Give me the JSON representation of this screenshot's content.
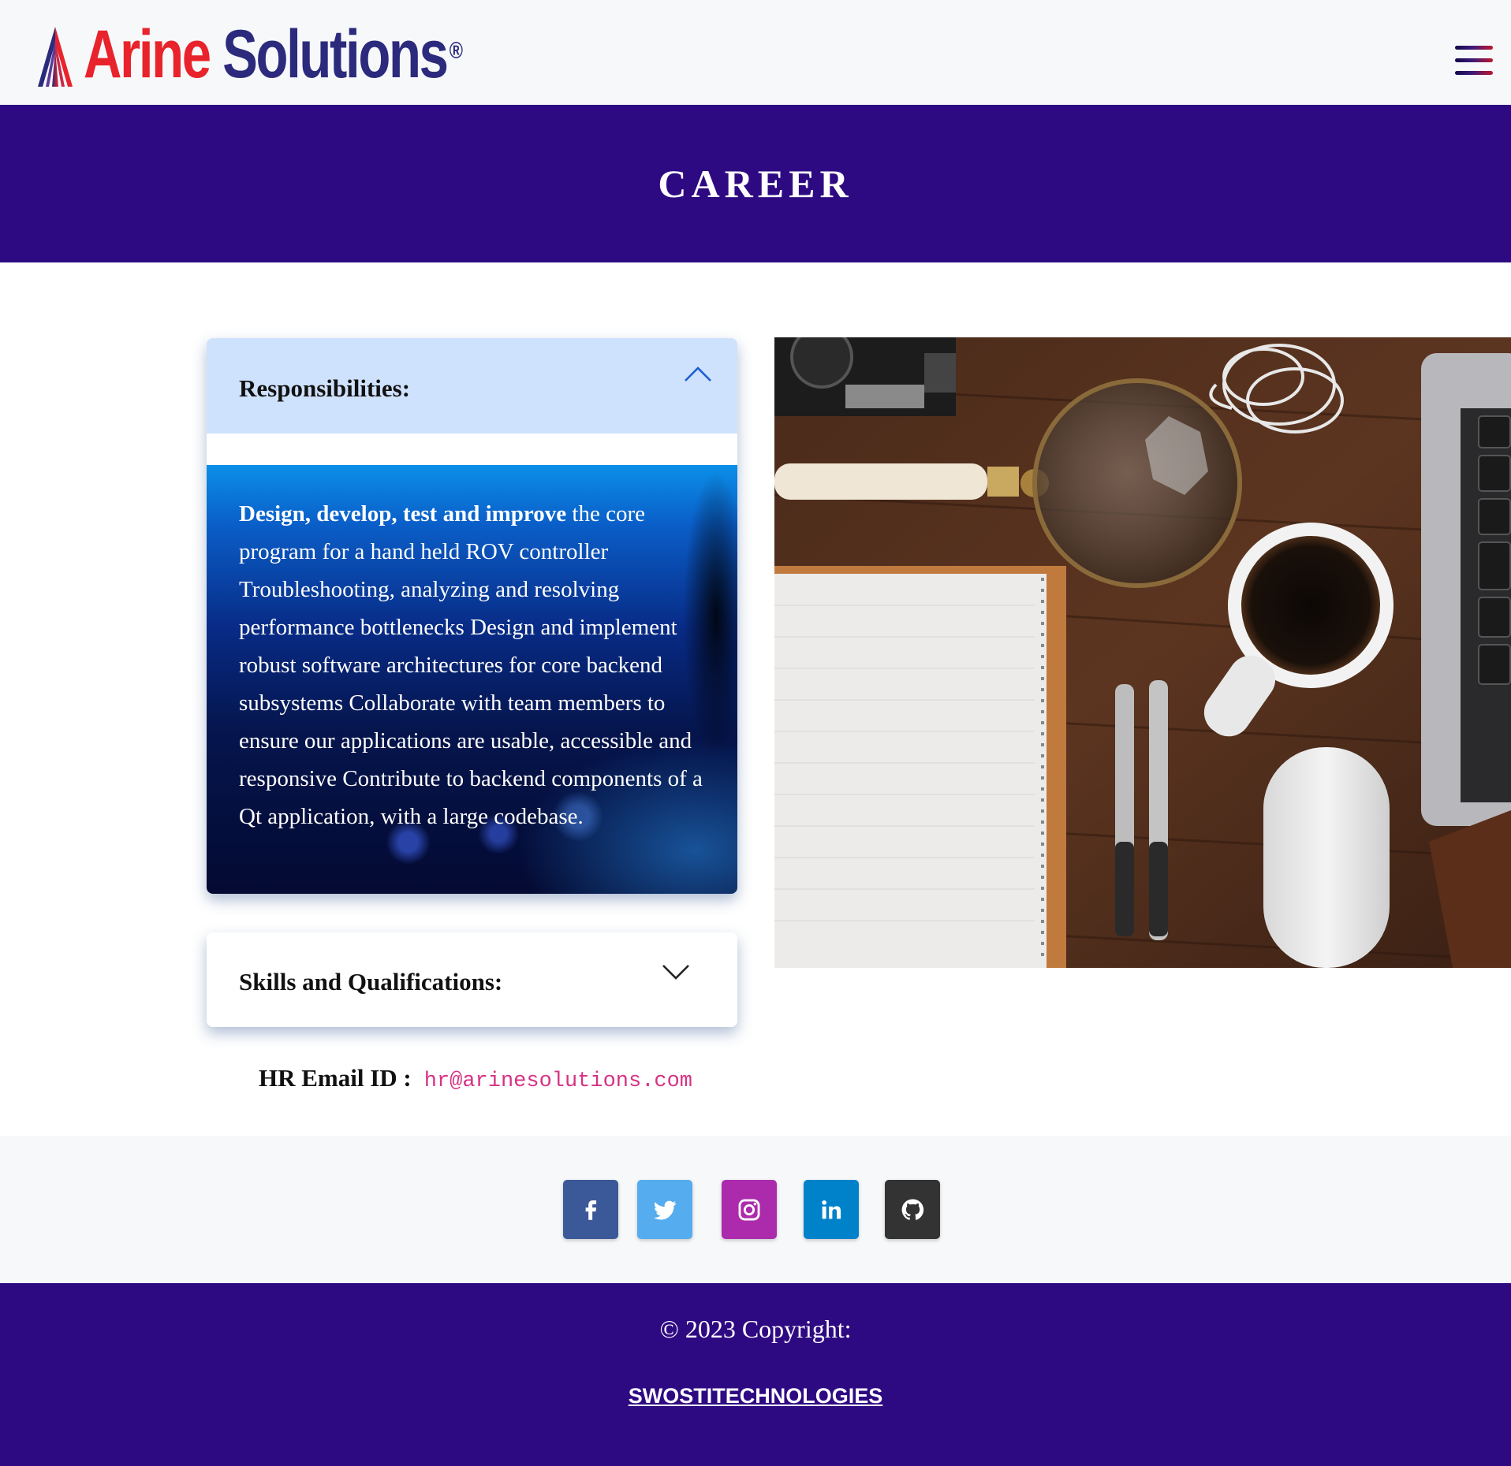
{
  "header": {
    "brand_arine": "Arine",
    "brand_solutions": "Solutions",
    "brand_reg": "®",
    "menu_icon": "hamburger-menu-icon"
  },
  "banner": {
    "title": "CAREER"
  },
  "accordion": {
    "responsibilities": {
      "title": "Responsibilities:",
      "expanded": true,
      "body_bold": "Design, develop, test and improve",
      "body_rest": " the core program for a hand held ROV controller Troubleshooting, analyzing and resolving performance bottlenecks Design and implement robust software architectures for core backend subsystems Collaborate with team members to ensure our applications are usable, accessible and responsive Contribute to backend components of a Qt application, with a large codebase."
    },
    "skills": {
      "title": "Skills and Qualifications:",
      "expanded": false
    }
  },
  "hr": {
    "label": "HR Email ID :",
    "email": "hr@arinesolutions.com"
  },
  "social": [
    {
      "name": "facebook",
      "icon": "facebook-icon",
      "color": "#3b5998"
    },
    {
      "name": "twitter",
      "icon": "twitter-icon",
      "color": "#55acee"
    },
    {
      "name": "instagram",
      "icon": "instagram-icon",
      "color": "#ac2bac"
    },
    {
      "name": "linkedin",
      "icon": "linkedin-icon",
      "color": "#0082ca"
    },
    {
      "name": "github",
      "icon": "github-icon",
      "color": "#333333"
    }
  ],
  "footer": {
    "copyright": "© 2023 Copyright:",
    "link": "SWOSTITECHNOLOGIES"
  },
  "colors": {
    "banner_bg": "#2e0a82",
    "accordion_active_header": "#cfe2fd",
    "email": "#d63384",
    "brand_red": "#e8232b",
    "brand_navy": "#2b2a7c"
  }
}
